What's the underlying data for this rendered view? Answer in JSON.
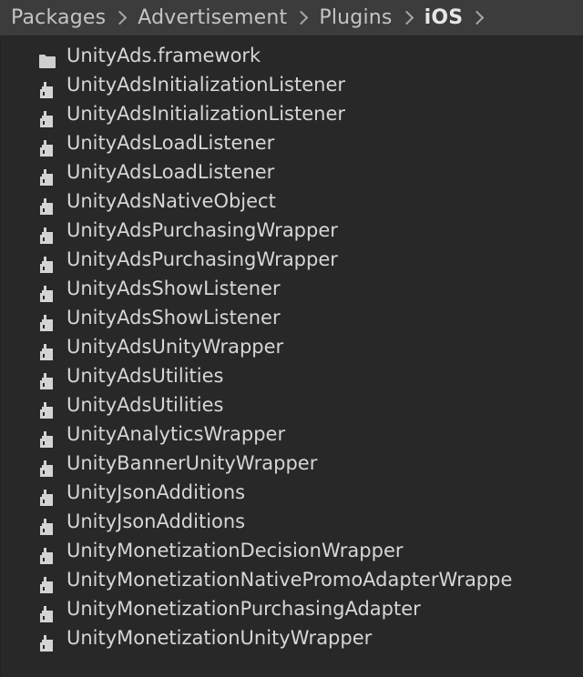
{
  "breadcrumb": {
    "items": [
      "Packages",
      "Advertisement",
      "Plugins",
      "iOS"
    ]
  },
  "colors": {
    "background": "#282828",
    "toolbar": "#3c3c3c",
    "text": "#d6d6d6",
    "icon": "#cfcfcf"
  },
  "files": [
    {
      "name": "UnityAds.framework",
      "icon": "folder-icon"
    },
    {
      "name": "UnityAdsInitializationListener",
      "icon": "plugin-file-icon"
    },
    {
      "name": "UnityAdsInitializationListener",
      "icon": "plugin-file-icon"
    },
    {
      "name": "UnityAdsLoadListener",
      "icon": "plugin-file-icon"
    },
    {
      "name": "UnityAdsLoadListener",
      "icon": "plugin-file-icon"
    },
    {
      "name": "UnityAdsNativeObject",
      "icon": "plugin-file-icon"
    },
    {
      "name": "UnityAdsPurchasingWrapper",
      "icon": "plugin-file-icon"
    },
    {
      "name": "UnityAdsPurchasingWrapper",
      "icon": "plugin-file-icon"
    },
    {
      "name": "UnityAdsShowListener",
      "icon": "plugin-file-icon"
    },
    {
      "name": "UnityAdsShowListener",
      "icon": "plugin-file-icon"
    },
    {
      "name": "UnityAdsUnityWrapper",
      "icon": "plugin-file-icon"
    },
    {
      "name": "UnityAdsUtilities",
      "icon": "plugin-file-icon"
    },
    {
      "name": "UnityAdsUtilities",
      "icon": "plugin-file-icon"
    },
    {
      "name": "UnityAnalyticsWrapper",
      "icon": "plugin-file-icon"
    },
    {
      "name": "UnityBannerUnityWrapper",
      "icon": "plugin-file-icon"
    },
    {
      "name": "UnityJsonAdditions",
      "icon": "plugin-file-icon"
    },
    {
      "name": "UnityJsonAdditions",
      "icon": "plugin-file-icon"
    },
    {
      "name": "UnityMonetizationDecisionWrapper",
      "icon": "plugin-file-icon"
    },
    {
      "name": "UnityMonetizationNativePromoAdapterWrappe",
      "icon": "plugin-file-icon"
    },
    {
      "name": "UnityMonetizationPurchasingAdapter",
      "icon": "plugin-file-icon"
    },
    {
      "name": "UnityMonetizationUnityWrapper",
      "icon": "plugin-file-icon"
    }
  ]
}
